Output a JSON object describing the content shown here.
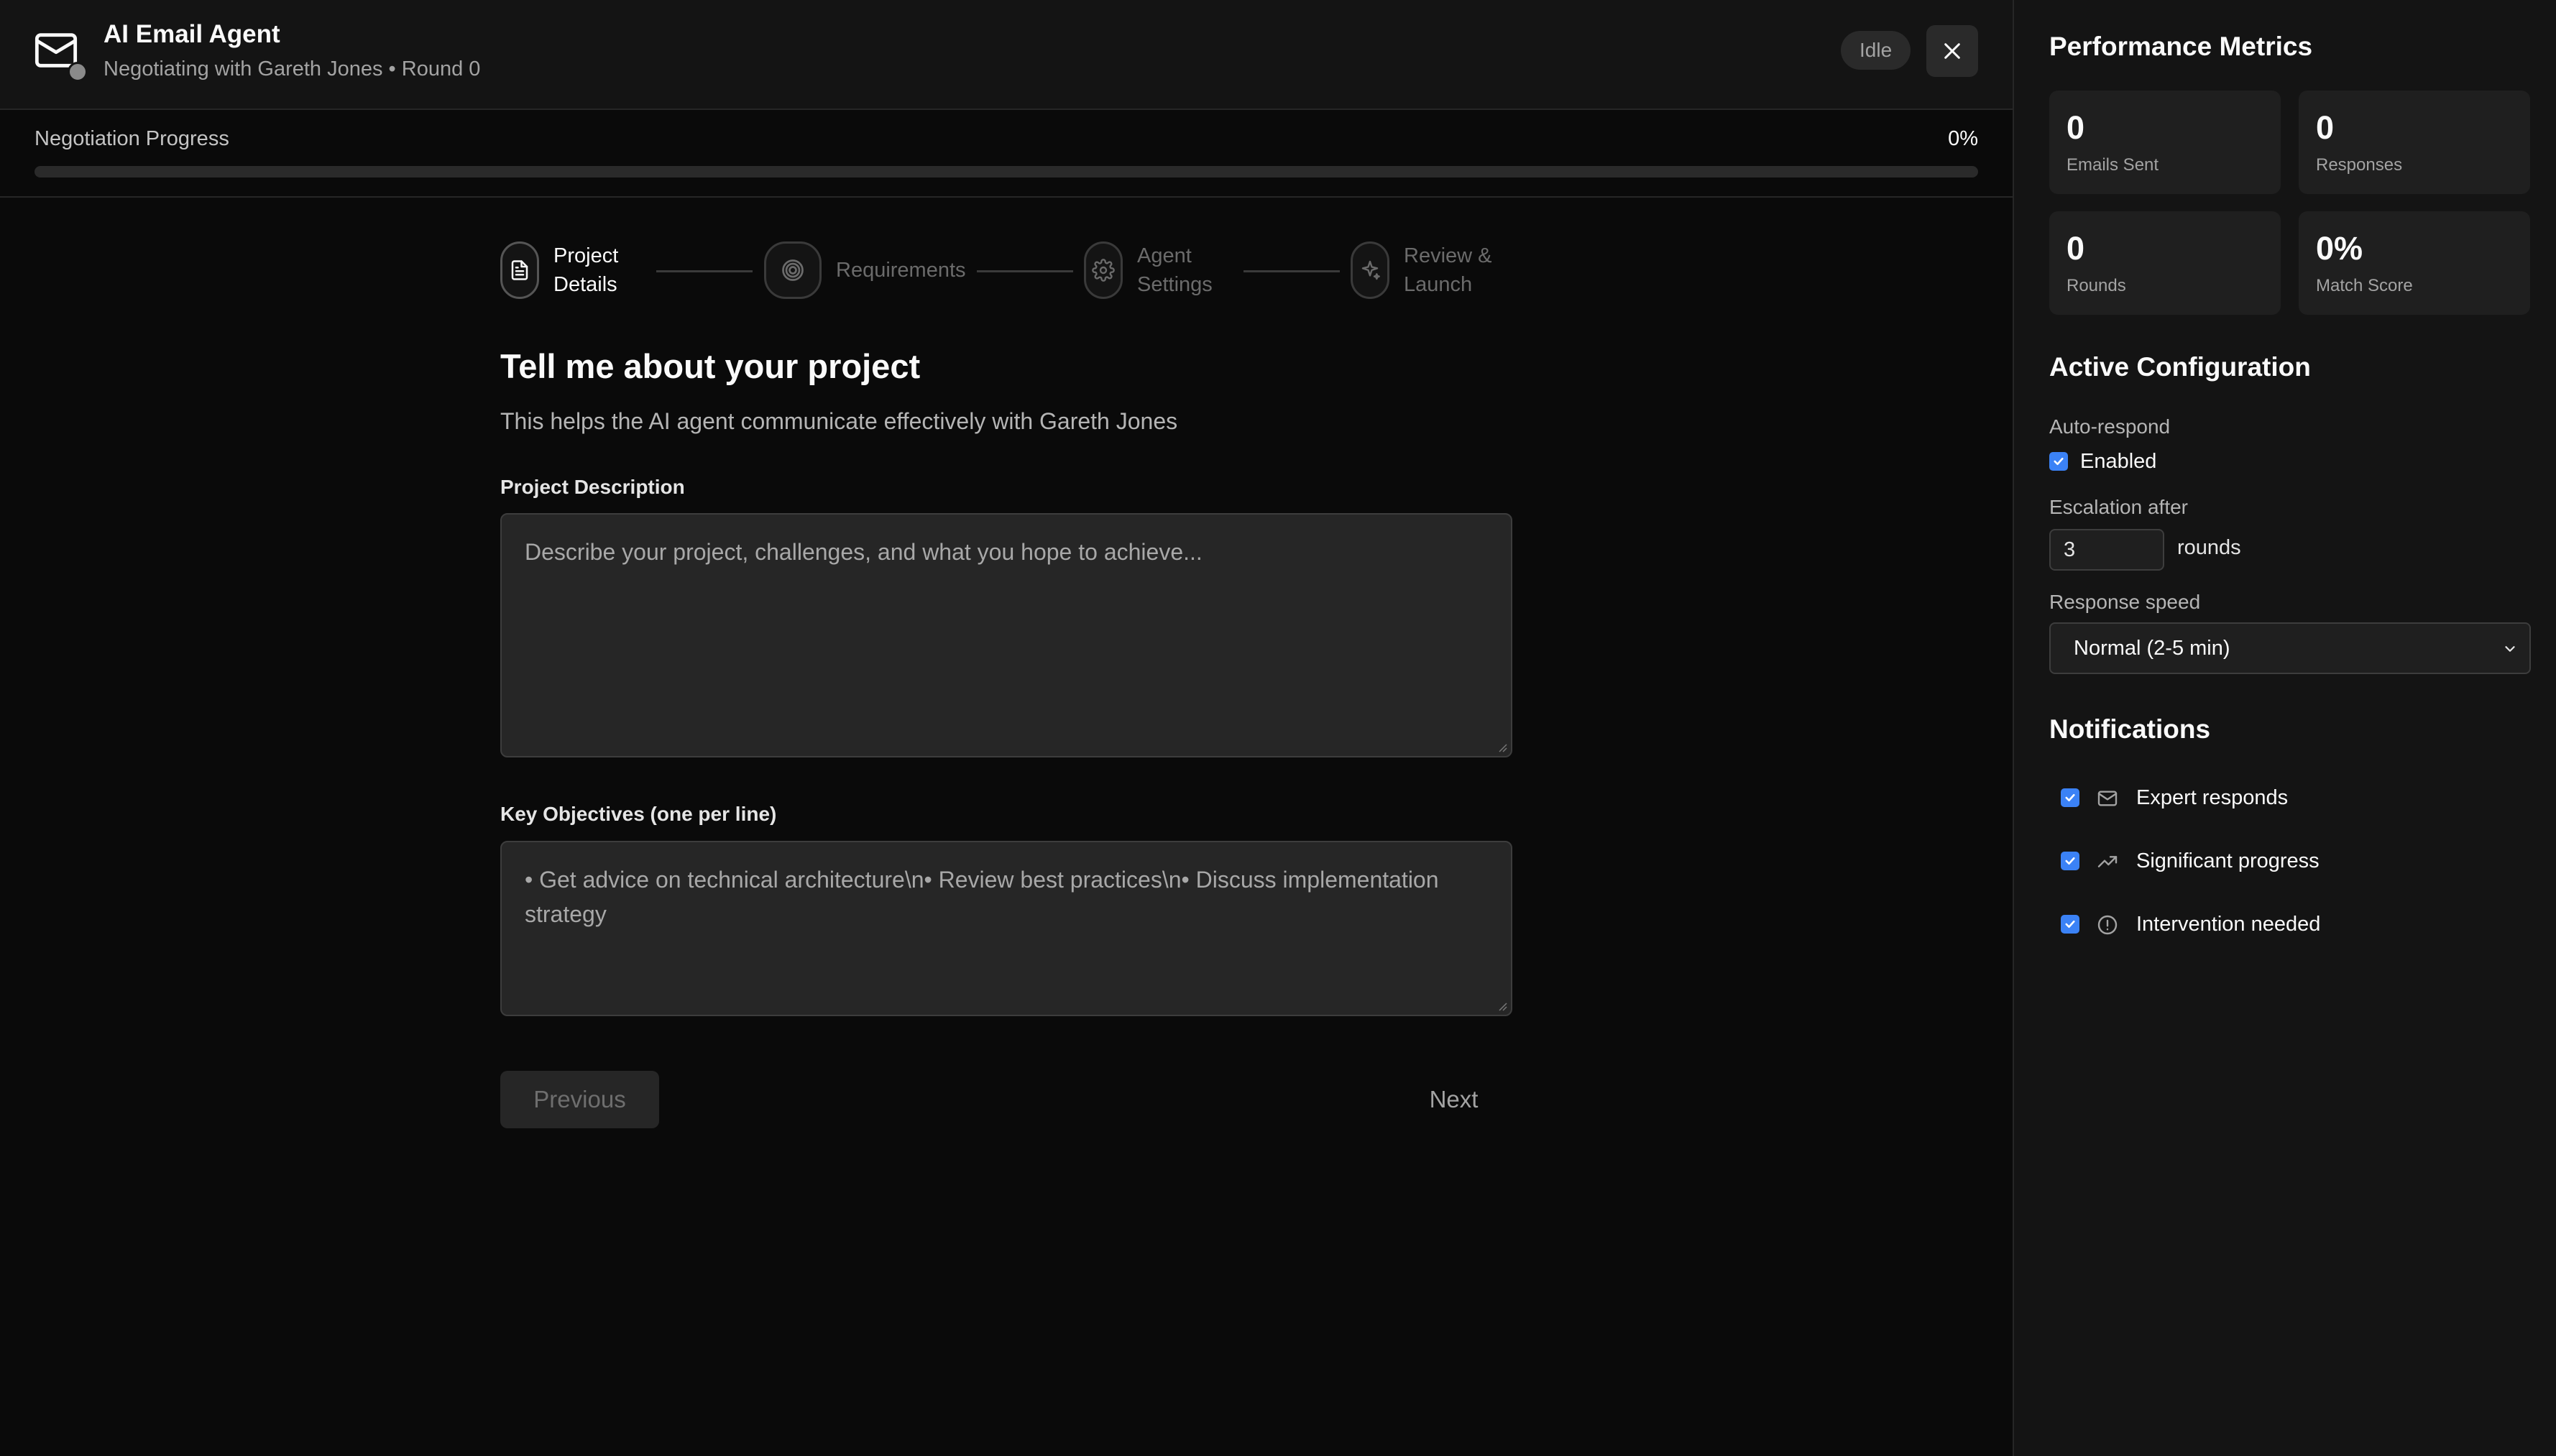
{
  "app": {
    "title": "AI Email Agent",
    "subtitle": "Negotiating with Gareth Jones • Round 0",
    "status_badge": "Idle",
    "icons": {
      "logo": "mail-icon",
      "close": "close-icon"
    }
  },
  "progress": {
    "label": "Negotiation Progress",
    "percent_text": "0%",
    "value": 0
  },
  "stepper": {
    "steps": [
      {
        "label_line1": "Project",
        "label_line2": "Details",
        "icon": "document-icon",
        "active": true
      },
      {
        "label_line1": "Requirements",
        "label_line2": "",
        "icon": "target-icon",
        "active": false
      },
      {
        "label_line1": "Agent",
        "label_line2": "Settings",
        "icon": "gear-icon",
        "active": false
      },
      {
        "label_line1": "Review &",
        "label_line2": "Launch",
        "icon": "sparkles-icon",
        "active": false
      }
    ]
  },
  "form": {
    "heading": "Tell me about your project",
    "subheading": "This helps the AI agent communicate effectively with Gareth Jones",
    "description_label": "Project Description",
    "description_placeholder": "Describe your project, challenges, and what you hope to achieve...",
    "objectives_label": "Key Objectives (one per line)",
    "objectives_placeholder": "• Get advice on technical architecture\\n• Review best practices\\n• Discuss implementation strategy",
    "previous_label": "Previous",
    "next_label": "Next"
  },
  "sidebar": {
    "metrics_title": "Performance Metrics",
    "metrics": [
      {
        "value": "0",
        "label": "Emails Sent"
      },
      {
        "value": "0",
        "label": "Responses"
      },
      {
        "value": "0",
        "label": "Rounds"
      },
      {
        "value": "0%",
        "label": "Match Score"
      }
    ],
    "config_title": "Active Configuration",
    "auto_respond_label": "Auto-respond",
    "auto_respond_option": "Enabled",
    "escalation_label": "Escalation after",
    "escalation_value": "3",
    "escalation_unit": "rounds",
    "speed_label": "Response speed",
    "speed_value": "Normal (2-5 min)",
    "notifications_title": "Notifications",
    "notifications": [
      {
        "label": "Expert responds",
        "icon": "mail-icon",
        "checked": true
      },
      {
        "label": "Significant progress",
        "icon": "trending-up-icon",
        "checked": true
      },
      {
        "label": "Intervention needed",
        "icon": "alert-circle-icon",
        "checked": true
      }
    ]
  },
  "colors": {
    "accent": "#3b82f6",
    "background": "#0a0a0a",
    "panel": "#141414"
  }
}
